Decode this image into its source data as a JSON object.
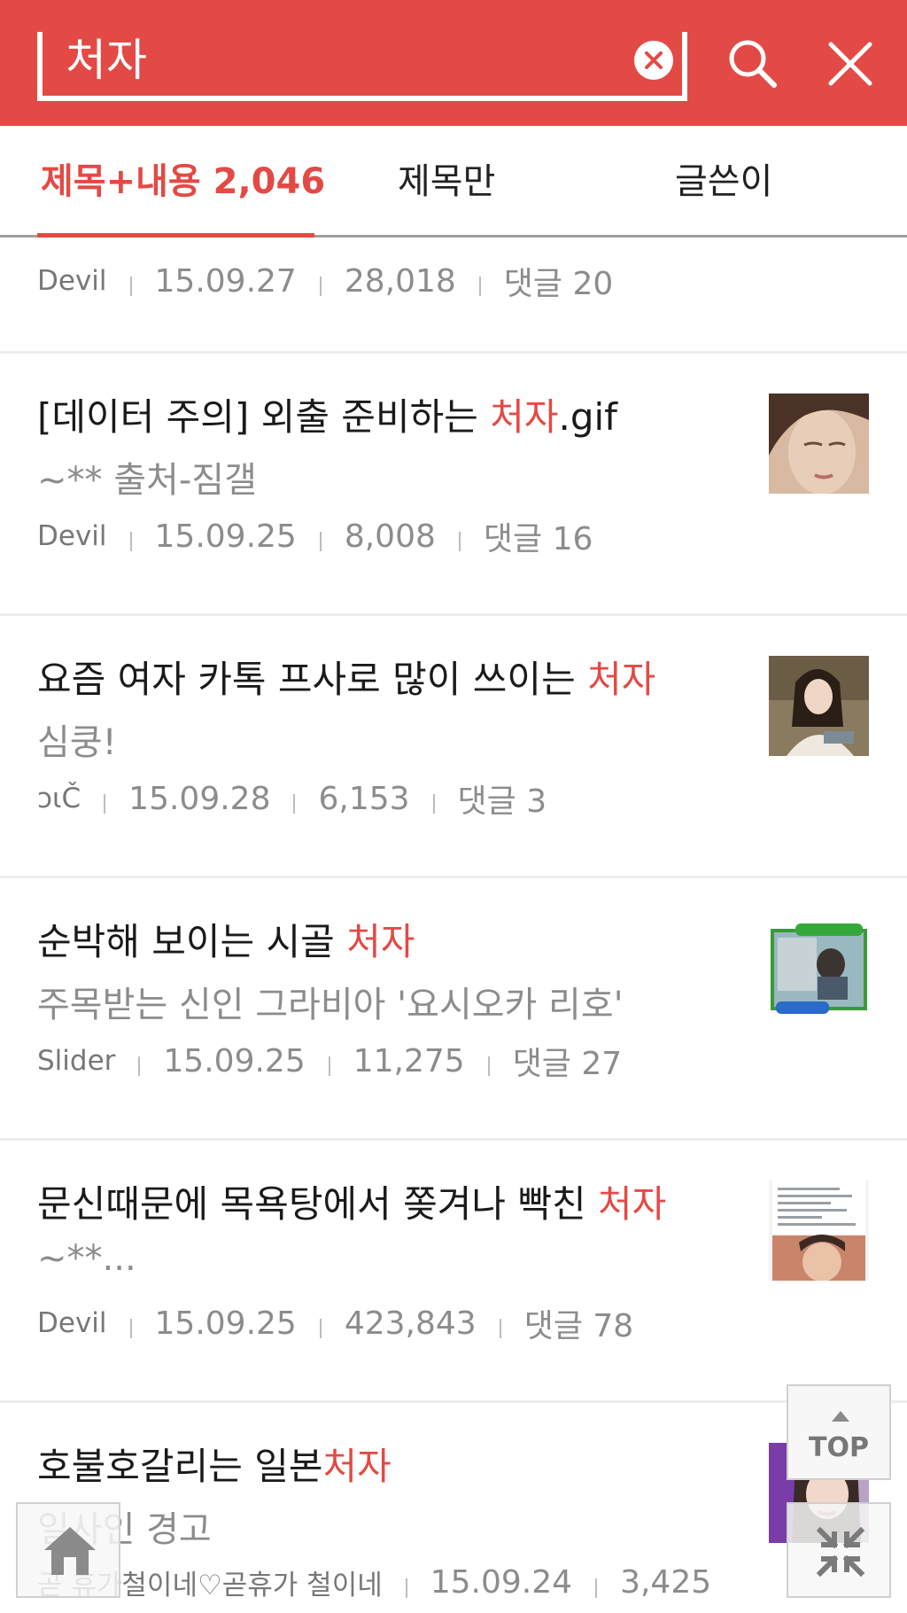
{
  "colors": {
    "accent": "#e34a45"
  },
  "search": {
    "value": "처자",
    "placeholder": ""
  },
  "tabs": [
    {
      "label": "제목+내용 2,046",
      "active": true
    },
    {
      "label": "제목만",
      "active": false
    },
    {
      "label": "글쓴이",
      "active": false
    }
  ],
  "items": [
    {
      "title_pre": "",
      "title_hl": "",
      "title_post": "",
      "subtitle": "",
      "author": "Devil",
      "date": "15.09.27",
      "views": "28,018",
      "comments": "댓글 20",
      "thumb": "partial-image"
    },
    {
      "title_pre": "[데이터 주의] 외출 준비하는 ",
      "title_hl": "처자",
      "title_post": ".gif",
      "subtitle": "~** 출처-짐갤",
      "author": "Devil",
      "date": "15.09.25",
      "views": "8,008",
      "comments": "댓글 16",
      "thumb": "woman-face-image"
    },
    {
      "title_pre": "요즘 여자 카톡 프사로 많이 쓰이는 ",
      "title_hl": "처자",
      "title_post": "",
      "subtitle": "심쿵!",
      "author": "ɔιČ",
      "date": "15.09.28",
      "views": "6,153",
      "comments": "댓글 3",
      "thumb": "woman-portrait-image"
    },
    {
      "title_pre": "순박해 보이는 시골 ",
      "title_hl": "처자",
      "title_post": "",
      "subtitle": "주목받는 신인 그라비아 '요시오카 리호'",
      "author": "Slider",
      "date": "15.09.25",
      "views": "11,275",
      "comments": "댓글 27",
      "thumb": "tv-caption-image"
    },
    {
      "title_pre": "문신때문에 목욕탕에서 쫒겨나 빡친 ",
      "title_hl": "처자",
      "title_post": "",
      "subtitle": "~**...",
      "author": "Devil",
      "date": "15.09.25",
      "views": "423,843",
      "comments": "댓글 78",
      "thumb": "screenshot-image"
    },
    {
      "title_pre": "호불호갈리는 일본",
      "title_hl": "처자",
      "title_post": "",
      "subtitle": "일사인 경고",
      "author": "곧 휴가철이네♡곧휴가 철이네",
      "date": "15.09.24",
      "views": "3,425",
      "comments": "",
      "thumb": "purple-portrait-image"
    }
  ],
  "floating": {
    "top_label": "TOP",
    "home_icon": "home-icon",
    "shrink_icon": "shrink-arrows-icon"
  },
  "icons": {
    "clear": "clear-x-circle-icon",
    "search": "search-icon",
    "close": "close-icon"
  }
}
